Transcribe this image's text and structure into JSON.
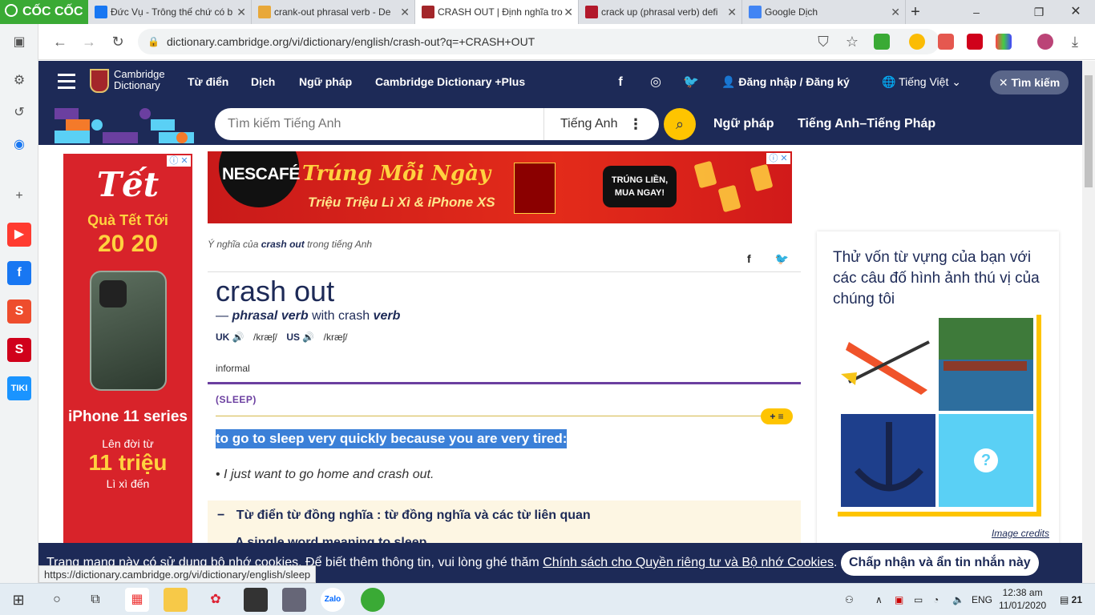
{
  "browser": {
    "brand": "CỐC CỐC",
    "tabs": [
      {
        "title": "Đức Vụ - Trông thế chứ có b",
        "color": "#1877f2"
      },
      {
        "title": "crank-out phrasal verb - De",
        "color": "#e8a83a"
      },
      {
        "title": "CRASH OUT | Định nghĩa tro",
        "color": "#a3262a"
      },
      {
        "title": "crack up (phrasal verb) defi",
        "color": "#b2182b"
      },
      {
        "title": "Google Dịch",
        "color": "#4285f4"
      }
    ],
    "url": "dictionary.cambridge.org/vi/dictionary/english/crash-out?q=+CRASH+OUT",
    "status_url": "https://dictionary.cambridge.org/vi/dictionary/english/sleep"
  },
  "header": {
    "brand_line1": "Cambridge",
    "brand_line2": "Dictionary",
    "nav": [
      "Từ điển",
      "Dịch",
      "Ngữ pháp",
      "Cambridge Dictionary +Plus"
    ],
    "login": "Đăng nhập / Đăng ký",
    "language": "Tiếng Việt",
    "search_button": "Tìm kiếm"
  },
  "search": {
    "placeholder": "Tìm kiếm Tiếng Anh",
    "language": "Tiếng Anh",
    "links": [
      "Ngữ pháp",
      "Tiếng Anh–Tiếng Pháp"
    ]
  },
  "ads": {
    "left": {
      "line1": "Tết",
      "line2": "Quà Tết Tới",
      "line3": "20 20",
      "series": "iPhone 11 series",
      "line4": "Lên đời từ",
      "line5": "11 triệu",
      "line6": "Lì xì đến"
    },
    "top": {
      "brand": "NESCAFÉ",
      "headline": "Trúng Mỗi Ngày",
      "sub": "Triệu Triệu Lì Xì & iPhone XS",
      "cta": "TRÚNG LIỀN, MUA NGAY!"
    }
  },
  "entry": {
    "breadcrumb_pre": "Ý nghĩa của",
    "breadcrumb_word": "crash out",
    "breadcrumb_post": "trong tiếng Anh",
    "headword": "crash out",
    "pos_prefix": "—",
    "pos": "phrasal verb",
    "pos_with": "with crash",
    "pos_verb": "verb",
    "uk_label": "UK",
    "uk_ipa": "/kræʃ/",
    "us_label": "US",
    "us_ipa": "/kræʃ/",
    "register": "informal",
    "guideword": "(SLEEP)",
    "definition": "to go to sleep very quickly because you are very tired:",
    "example": "I just want to go home and crash out.",
    "thesaurus_1": "Từ điển từ đồng nghĩa : từ đồng nghĩa và các từ liên quan",
    "thesaurus_2": "A single word meaning to sleep"
  },
  "quiz": {
    "title": "Thử vốn từ vựng của bạn với các câu đố hình ảnh thú vị của chúng tôi",
    "credits": "Image credits"
  },
  "cookie": {
    "text": "Trang mạng này có sử dụng bộ nhớ cookies. Để biết thêm thông tin, vui lòng ghé thăm",
    "link": "Chính sách cho Quyền riêng tư và Bộ nhớ Cookies",
    "accept": "Chấp nhận và ẩn tin nhắn này"
  },
  "taskbar": {
    "lang": "ENG",
    "time": "12:38 am",
    "date": "11/01/2020",
    "notif": "21"
  }
}
